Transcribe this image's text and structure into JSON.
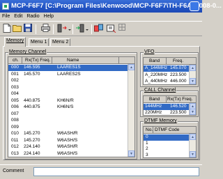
{
  "window": {
    "title": "MCP-F6F7 [C:\\Program Files\\Kenwood\\MCP-F6F7\\TH-F6A_2008-0..."
  },
  "menu": [
    "File",
    "Edit",
    "Radio",
    "Help"
  ],
  "tabs": [
    "Memory",
    "Menu 1",
    "Menu 2"
  ],
  "memory": {
    "title": "Memory Channel",
    "headers": {
      "ch": "ch.",
      "freq": "Rx(Tx) Freq.",
      "name": "Name"
    },
    "rows": [
      {
        "ch": "000",
        "freq": "146.595",
        "name": "LAARES1S",
        "selected": true
      },
      {
        "ch": "001",
        "freq": "145.570",
        "name": "LAARES2S"
      },
      {
        "ch": "002",
        "freq": "",
        "name": ""
      },
      {
        "ch": "003",
        "freq": "",
        "name": ""
      },
      {
        "ch": "004",
        "freq": "",
        "name": ""
      },
      {
        "ch": "005",
        "freq": "440.875",
        "name": "KH6N/R"
      },
      {
        "ch": "006",
        "freq": "440.875",
        "name": "KH6N/S"
      },
      {
        "ch": "007",
        "freq": "",
        "name": ""
      },
      {
        "ch": "008",
        "freq": "",
        "name": ""
      },
      {
        "ch": "009",
        "freq": "",
        "name": ""
      },
      {
        "ch": "010",
        "freq": "145.270",
        "name": "W6ASH/R"
      },
      {
        "ch": "011",
        "freq": "145.270",
        "name": "W6ASH/S"
      },
      {
        "ch": "012",
        "freq": "224.140",
        "name": "W6ASH/R"
      },
      {
        "ch": "013",
        "freq": "224.140",
        "name": "W6ASH/S"
      }
    ]
  },
  "vfo": {
    "title": "VFO",
    "headers": {
      "band": "Band",
      "freq": "Freq."
    },
    "rows": [
      {
        "band": "A_144MHz",
        "freq": "145.070",
        "selected": true
      },
      {
        "band": "A_220MHz",
        "freq": "223.500"
      },
      {
        "band": "A_440MHz",
        "freq": "446.000"
      }
    ]
  },
  "call": {
    "title": "CALL Channel",
    "headers": {
      "band": "Band",
      "freq": "Rx(Tx) Freq."
    },
    "rows": [
      {
        "band": "144MHz",
        "freq": "146.520",
        "selected": true
      },
      {
        "band": "220MHz",
        "freq": "223.500"
      }
    ]
  },
  "dtmf": {
    "title": "DTMF Memory",
    "headers": {
      "no": "No.",
      "code": "DTMF Code"
    },
    "rows": [
      {
        "no": "0",
        "code": "",
        "selected": true
      },
      {
        "no": "1",
        "code": ""
      },
      {
        "no": "2",
        "code": ""
      },
      {
        "no": "3",
        "code": ""
      }
    ]
  },
  "comment": {
    "label": "Comment",
    "value": ""
  },
  "colors": {
    "titlebar": "#2458c8",
    "selection": "#316ac5",
    "face": "#d4d0c8"
  }
}
